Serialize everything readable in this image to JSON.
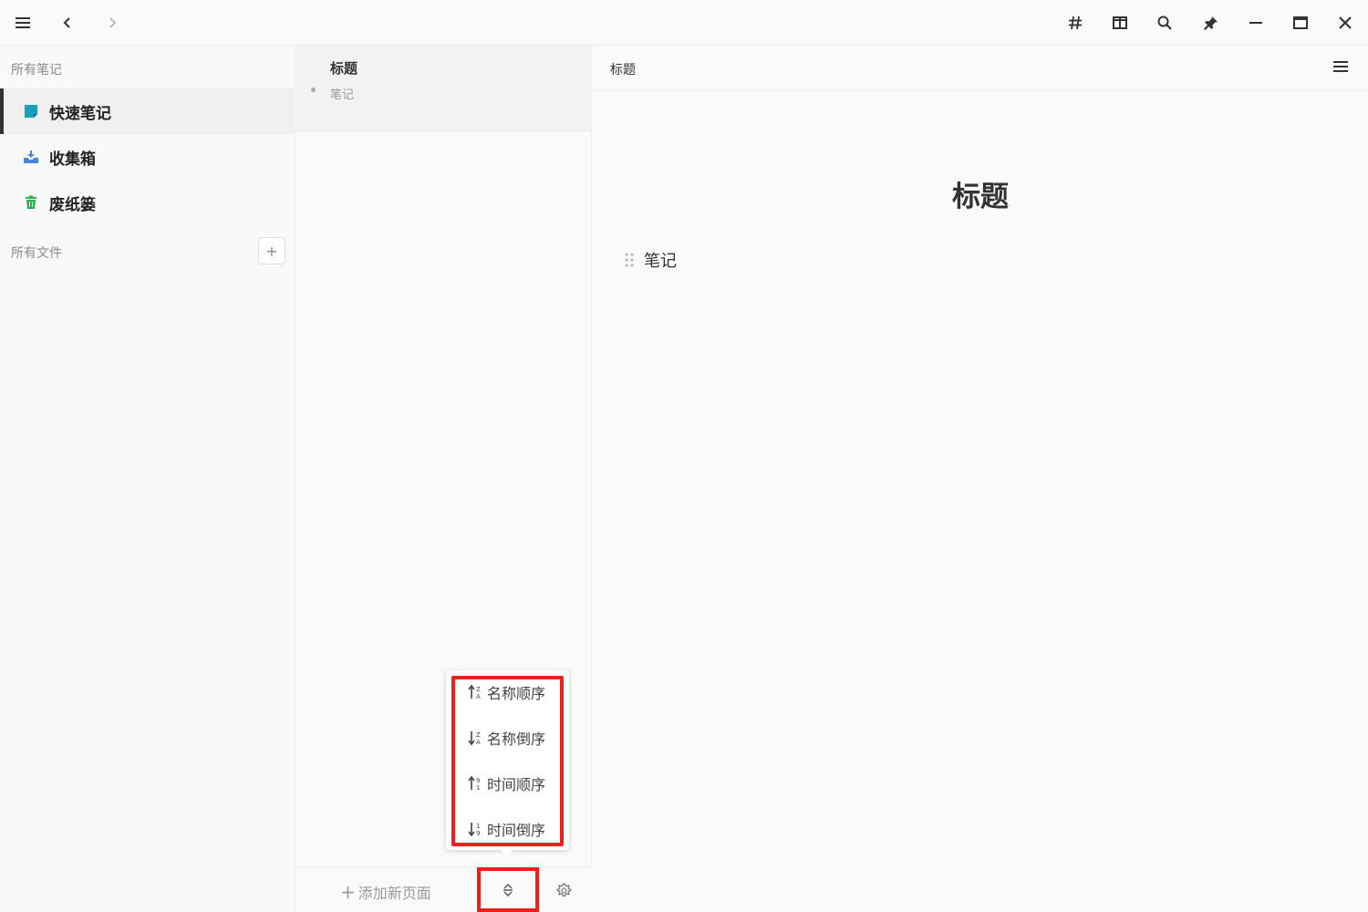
{
  "titlebar": {
    "icons": [
      "menu-icon",
      "back-icon",
      "forward-icon",
      "hash-icon",
      "split-view-icon",
      "search-icon",
      "pin-icon",
      "minimize-icon",
      "maximize-icon",
      "close-icon"
    ]
  },
  "sidebar": {
    "all_notes_label": "所有笔记",
    "items": [
      {
        "label": "快速笔记",
        "icon": "quick-note-icon",
        "color": "#1aa0b8",
        "active": true
      },
      {
        "label": "收集箱",
        "icon": "inbox-icon",
        "color": "#4a84d8",
        "active": false
      },
      {
        "label": "废纸篓",
        "icon": "trash-icon",
        "color": "#2fae4a",
        "active": false
      }
    ],
    "all_files_label": "所有文件",
    "add_folder_symbol": "+"
  },
  "list": {
    "notes": [
      {
        "title": "标题",
        "snippet": "笔记"
      }
    ],
    "footer": {
      "add_page_symbol": "+",
      "add_page_label": "添加新页面"
    }
  },
  "sort_menu": {
    "options": [
      {
        "label": "名称顺序",
        "icon": "sort-name-asc-icon"
      },
      {
        "label": "名称倒序",
        "icon": "sort-name-desc-icon"
      },
      {
        "label": "时间顺序",
        "icon": "sort-time-asc-icon"
      },
      {
        "label": "时间倒序",
        "icon": "sort-time-desc-icon"
      }
    ]
  },
  "editor": {
    "breadcrumb": "标题",
    "title": "标题",
    "blocks": [
      {
        "text": "笔记"
      }
    ]
  },
  "colors": {
    "highlight": "#f01d1d",
    "active_bar": "#333333"
  }
}
